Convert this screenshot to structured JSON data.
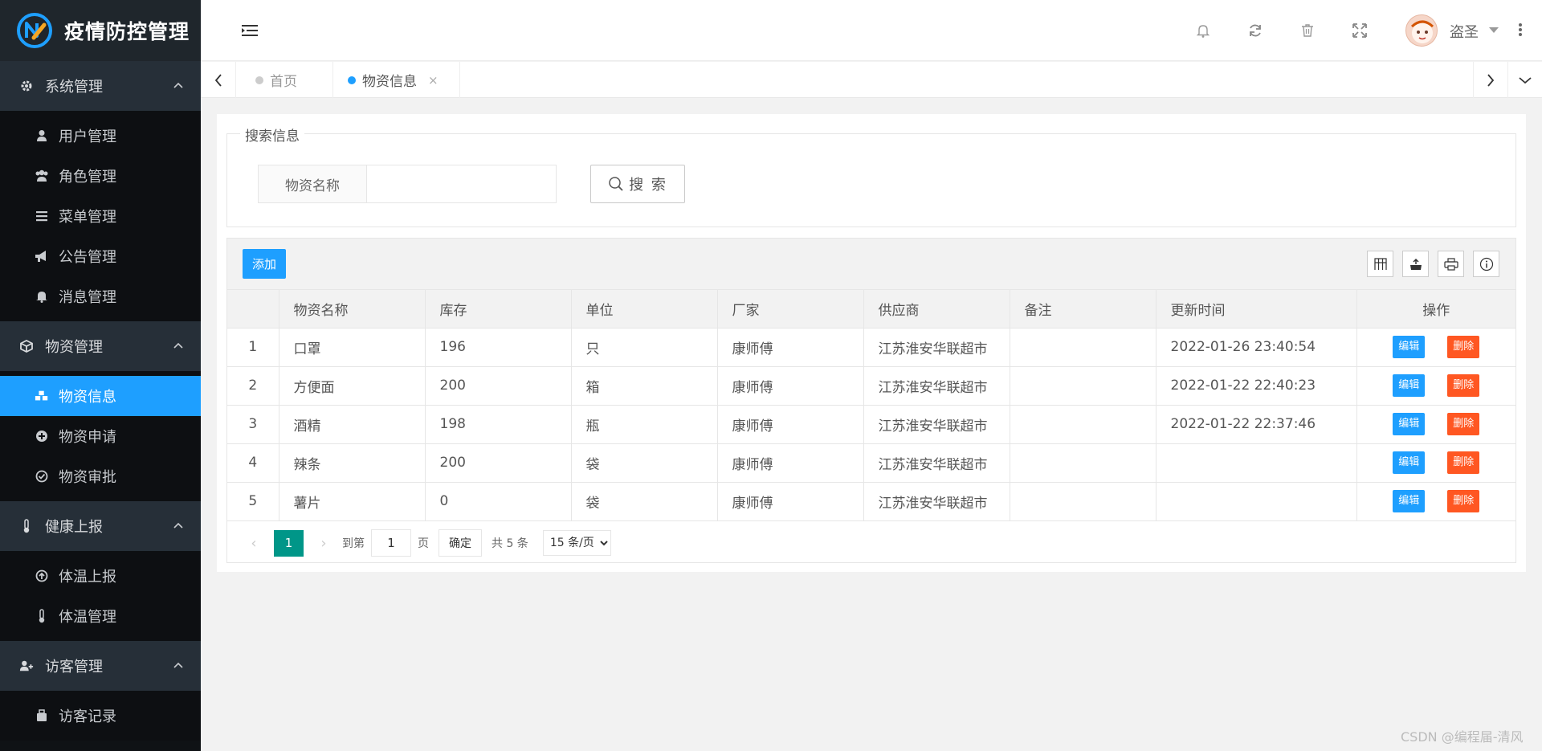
{
  "app": {
    "title": "疫情防控管理"
  },
  "sidebar": {
    "groups": [
      {
        "label": "系统管理",
        "icon": "gear-icon",
        "items": [
          {
            "label": "用户管理",
            "icon": "user-icon"
          },
          {
            "label": "角色管理",
            "icon": "users-icon"
          },
          {
            "label": "菜单管理",
            "icon": "menu-icon"
          },
          {
            "label": "公告管理",
            "icon": "bullhorn-icon"
          },
          {
            "label": "消息管理",
            "icon": "bell-icon"
          }
        ]
      },
      {
        "label": "物资管理",
        "icon": "cube-icon",
        "items": [
          {
            "label": "物资信息",
            "icon": "cubes-icon",
            "active": true
          },
          {
            "label": "物资申请",
            "icon": "plus-circle-icon"
          },
          {
            "label": "物资审批",
            "icon": "check-circle-icon"
          }
        ]
      },
      {
        "label": "健康上报",
        "icon": "thermometer-icon",
        "items": [
          {
            "label": "体温上报",
            "icon": "arrow-up-circle-icon"
          },
          {
            "label": "体温管理",
            "icon": "thermometer-icon"
          }
        ]
      },
      {
        "label": "访客管理",
        "icon": "user-plus-icon",
        "items": [
          {
            "label": "访客记录",
            "icon": "suitcase-icon"
          }
        ]
      }
    ]
  },
  "header": {
    "username": "盗圣",
    "icons": [
      "bell-icon",
      "refresh-icon",
      "trash-icon",
      "fullscreen-icon"
    ]
  },
  "tabs": [
    {
      "label": "首页",
      "current": false
    },
    {
      "label": "物资信息",
      "current": true,
      "close": "×"
    }
  ],
  "search": {
    "legend": "搜索信息",
    "field_label": "物资名称",
    "field_value": "",
    "button_label": "搜 索"
  },
  "table": {
    "add_label": "添加",
    "columns": [
      "",
      "物资名称",
      "库存",
      "单位",
      "厂家",
      "供应商",
      "备注",
      "更新时间",
      "操作"
    ],
    "rows": [
      {
        "idx": "1",
        "name": "口罩",
        "stock": "196",
        "unit": "只",
        "maker": "康师傅",
        "supplier": "江苏淮安华联超市",
        "note": "",
        "updated": "2022-01-26 23:40:54"
      },
      {
        "idx": "2",
        "name": "方便面",
        "stock": "200",
        "unit": "箱",
        "maker": "康师傅",
        "supplier": "江苏淮安华联超市",
        "note": "",
        "updated": "2022-01-22 22:40:23"
      },
      {
        "idx": "3",
        "name": "酒精",
        "stock": "198",
        "unit": "瓶",
        "maker": "康师傅",
        "supplier": "江苏淮安华联超市",
        "note": "",
        "updated": "2022-01-22 22:37:46"
      },
      {
        "idx": "4",
        "name": "辣条",
        "stock": "200",
        "unit": "袋",
        "maker": "康师傅",
        "supplier": "江苏淮安华联超市",
        "note": "",
        "updated": ""
      },
      {
        "idx": "5",
        "name": "薯片",
        "stock": "0",
        "unit": "袋",
        "maker": "康师傅",
        "supplier": "江苏淮安华联超市",
        "note": "",
        "updated": ""
      }
    ],
    "edit_label": "编辑",
    "delete_label": "删除"
  },
  "pager": {
    "current": "1",
    "goto_label": "到第",
    "goto_value": "1",
    "page_label": "页",
    "ok_label": "确定",
    "total": "共 5 条",
    "size_option": "15 条/页"
  },
  "watermark": "CSDN @编程届-清风"
}
